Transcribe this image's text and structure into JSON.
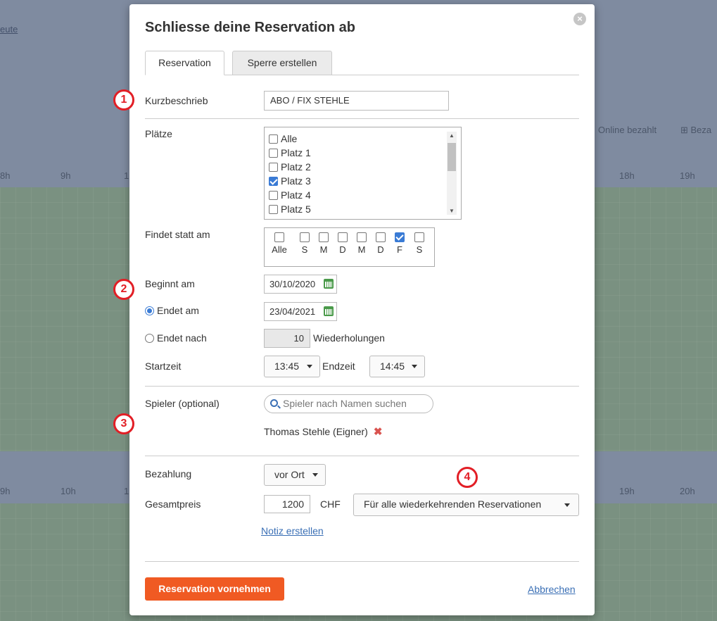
{
  "background": {
    "link_heute": "eute",
    "online_bezahlt": "Online bezahlt",
    "bez_label": "Beza",
    "hours_top": [
      "8h",
      "9h",
      "1",
      "18h",
      "19h"
    ],
    "hours_bottom": [
      "9h",
      "10h",
      "1",
      "19h",
      "20h"
    ]
  },
  "modal": {
    "title": "Schliesse deine Reservation ab",
    "close_label": "×",
    "tabs": [
      {
        "label": "Reservation",
        "active": true
      },
      {
        "label": "Sperre erstellen",
        "active": false
      }
    ],
    "kurzbeschrieb": {
      "label": "Kurzbeschrieb",
      "value": "ABO / FIX STEHLE"
    },
    "plaetze": {
      "label": "Plätze",
      "items": [
        {
          "label": "Alle",
          "checked": false
        },
        {
          "label": "Platz 1",
          "checked": false
        },
        {
          "label": "Platz 2",
          "checked": false
        },
        {
          "label": "Platz 3",
          "checked": true
        },
        {
          "label": "Platz 4",
          "checked": false
        },
        {
          "label": "Platz 5",
          "checked": false
        }
      ]
    },
    "findet_statt": {
      "label": "Findet statt am",
      "days": [
        {
          "label": "Alle",
          "checked": false
        },
        {
          "label": "S",
          "checked": false
        },
        {
          "label": "M",
          "checked": false
        },
        {
          "label": "D",
          "checked": false
        },
        {
          "label": "M",
          "checked": false
        },
        {
          "label": "D",
          "checked": false
        },
        {
          "label": "F",
          "checked": true
        },
        {
          "label": "S",
          "checked": false
        }
      ]
    },
    "beginnt_am": {
      "label": "Beginnt am",
      "value": "30/10/2020"
    },
    "endet_am": {
      "label": "Endet am",
      "value": "23/04/2021",
      "selected": true
    },
    "endet_nach": {
      "label": "Endet nach",
      "value": "10",
      "suffix": "Wiederholungen",
      "selected": false
    },
    "startzeit": {
      "label": "Startzeit",
      "value": "13:45"
    },
    "endzeit": {
      "label": "Endzeit",
      "value": "14:45"
    },
    "spieler": {
      "label": "Spieler (optional)",
      "placeholder": "Spieler nach Namen suchen",
      "players": [
        "Thomas Stehle (Eigner)"
      ]
    },
    "bezahlung": {
      "label": "Bezahlung",
      "value": "vor Ort"
    },
    "gesamtpreis": {
      "label": "Gesamtpreis",
      "value": "1200",
      "currency": "CHF",
      "scope": "Für alle wiederkehrenden Reservationen"
    },
    "notiz_link": "Notiz erstellen",
    "submit_label": "Reservation vornehmen",
    "cancel_label": "Abbrechen"
  },
  "markers": [
    "1",
    "2",
    "3",
    "4"
  ],
  "colors": {
    "primary": "#f05a23",
    "link": "#3a6fb5",
    "marker": "#e21e25",
    "check": "#3a7bd5"
  }
}
